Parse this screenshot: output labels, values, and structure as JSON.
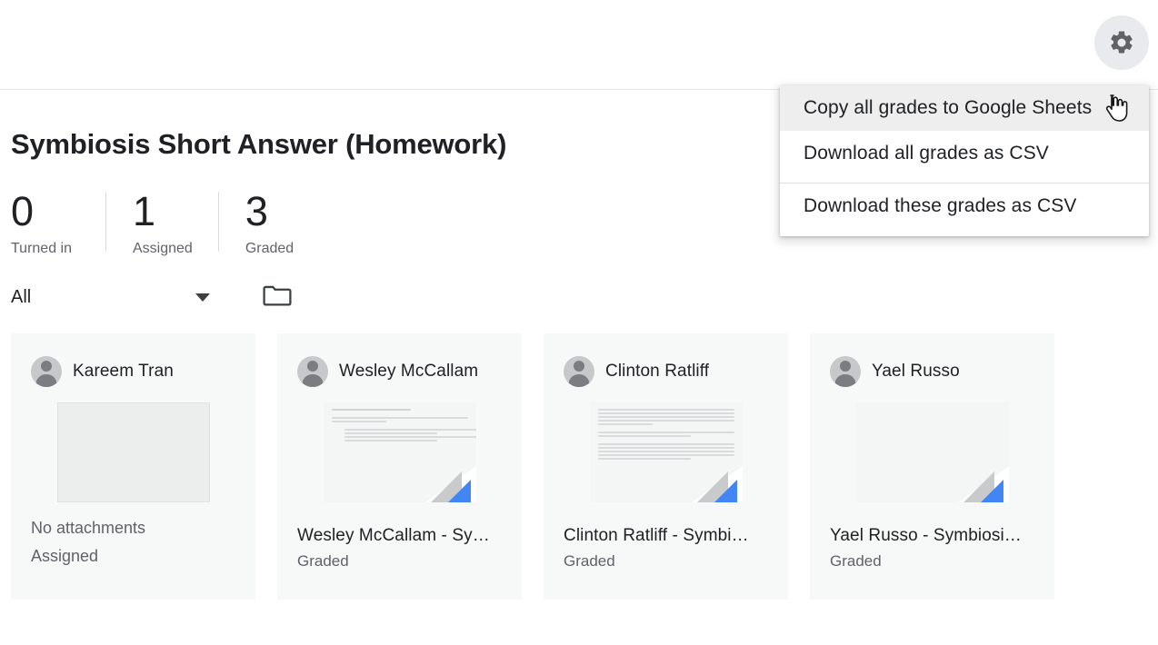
{
  "topbar": {
    "settings_button": "settings-gear"
  },
  "menu": {
    "items": [
      {
        "label": "Copy all grades to Google Sheets",
        "hovered": true,
        "separator_before": false
      },
      {
        "label": "Download all grades as CSV",
        "hovered": false,
        "separator_before": false
      },
      {
        "label": "Download these grades as CSV",
        "hovered": false,
        "separator_before": true
      }
    ]
  },
  "assignment": {
    "title": "Symbiosis Short Answer (Homework)",
    "stats": [
      {
        "number": "0",
        "label": "Turned in"
      },
      {
        "number": "1",
        "label": "Assigned"
      },
      {
        "number": "3",
        "label": "Graded"
      }
    ]
  },
  "filter": {
    "selected": "All",
    "folder_icon": "folder-icon"
  },
  "students": [
    {
      "name": "Kareem Tran",
      "thumb_type": "empty",
      "doc_title": "",
      "status": "Assigned",
      "attachments_text": "No attachments",
      "has_doc": false
    },
    {
      "name": "Wesley McCallam",
      "thumb_type": "doc-bullets",
      "doc_title": "Wesley McCallam - Sy…",
      "status": "Graded",
      "attachments_text": "",
      "has_doc": true
    },
    {
      "name": "Clinton Ratliff",
      "thumb_type": "doc-paragraphs",
      "doc_title": "Clinton Ratliff - Symbi…",
      "status": "Graded",
      "attachments_text": "",
      "has_doc": true
    },
    {
      "name": "Yael Russo",
      "thumb_type": "doc-blank",
      "doc_title": "Yael Russo - Symbiosi…",
      "status": "Graded",
      "attachments_text": "",
      "has_doc": true
    }
  ],
  "colors": {
    "doc_blue": "#4285f4",
    "fold_gray": "#c8cacc",
    "card_bg": "#f7f8f8",
    "text_primary": "#202124",
    "text_secondary": "#5f6368",
    "menu_hover": "#eeeeee"
  },
  "cursor": {
    "type": "pointer-hand"
  }
}
